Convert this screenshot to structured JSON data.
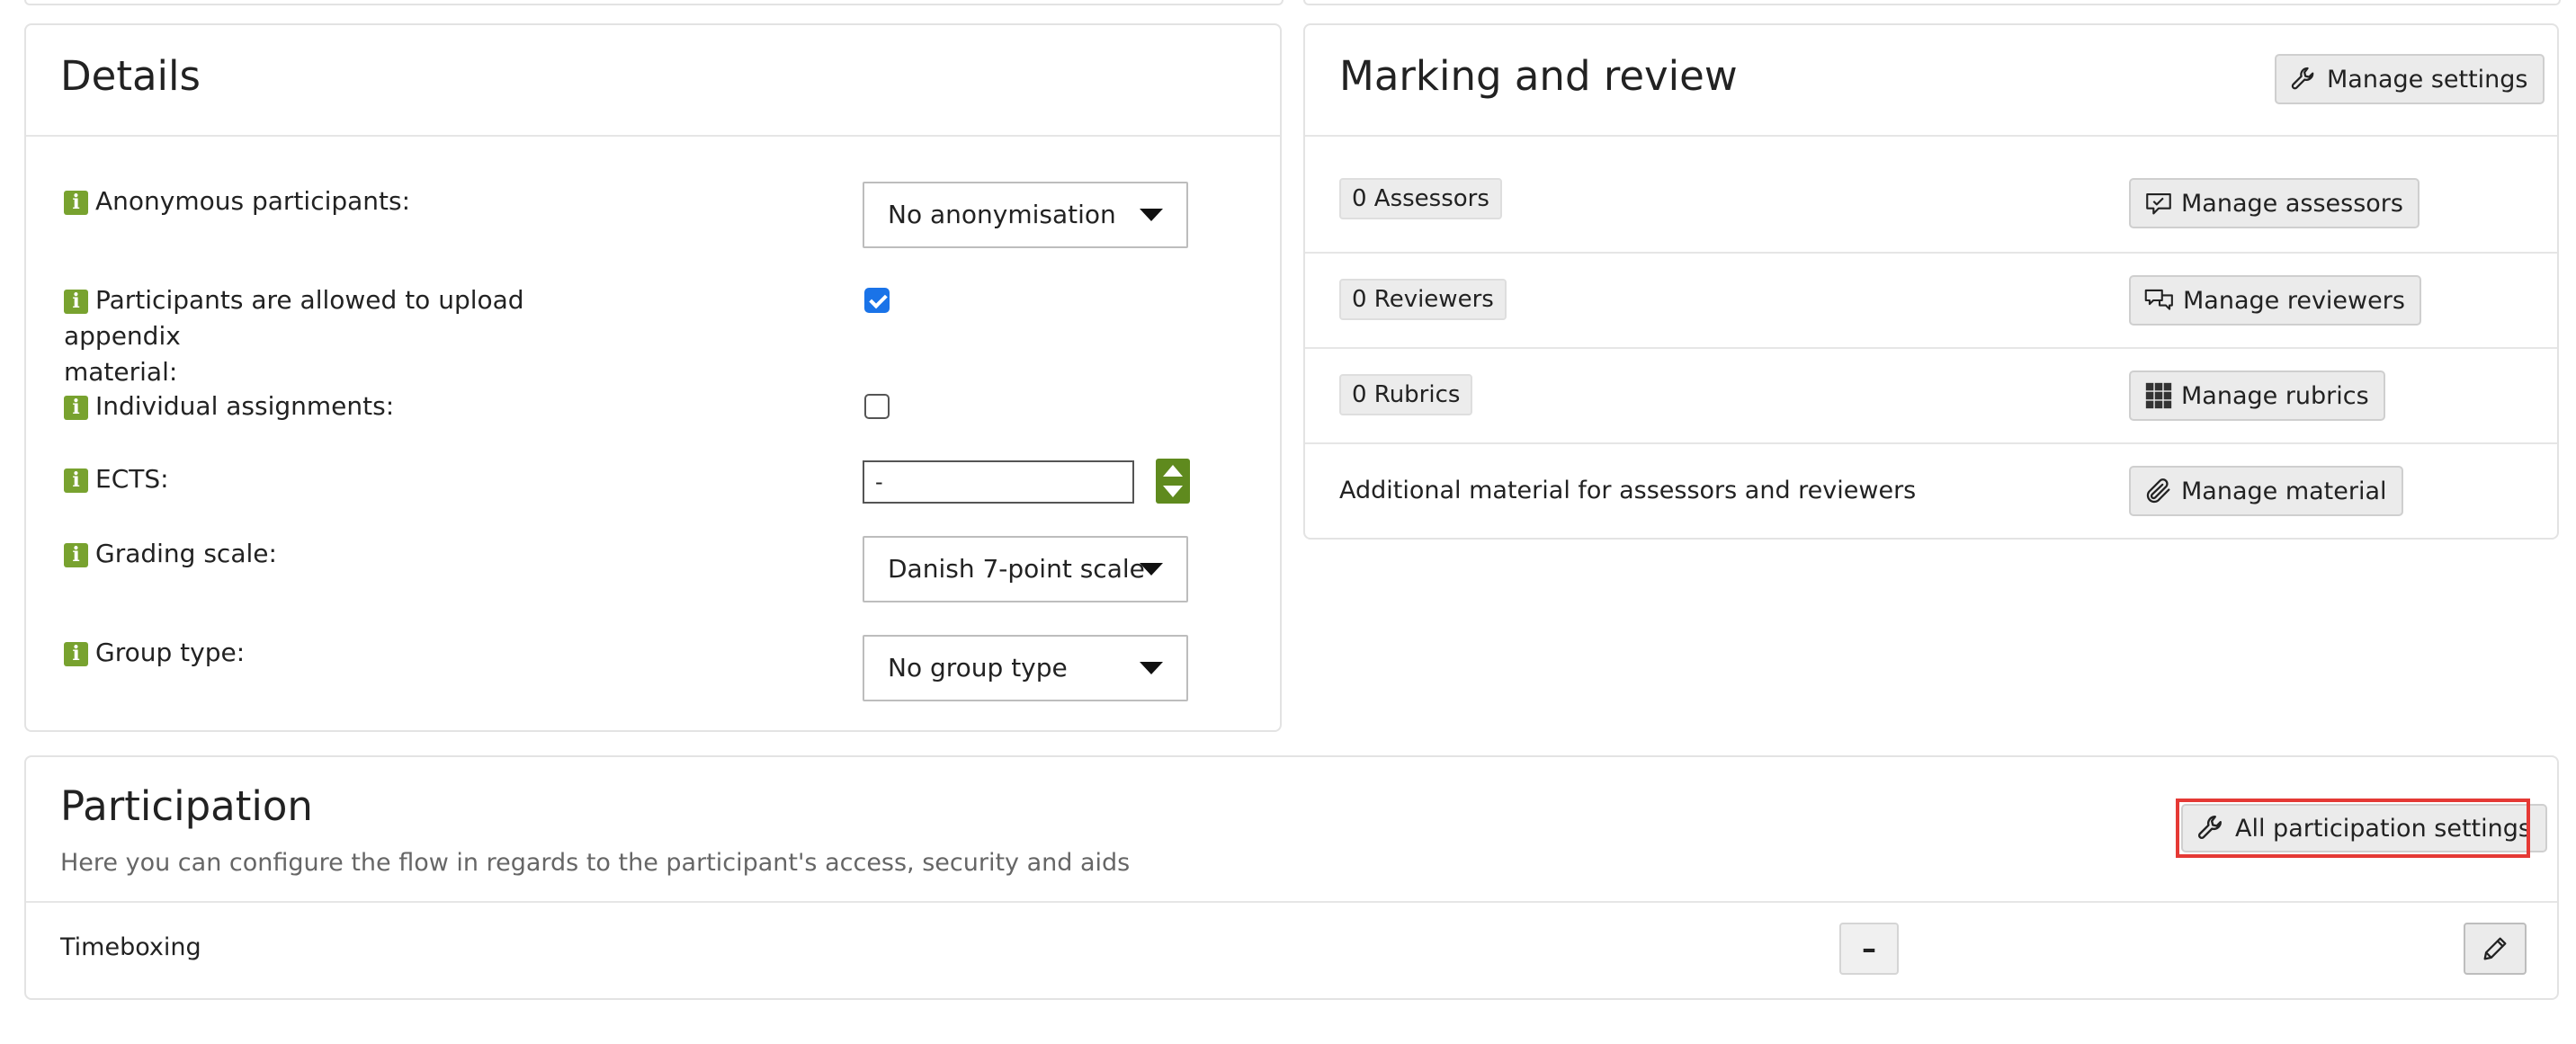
{
  "details": {
    "title": "Details",
    "fields": {
      "anonymous_label": "Anonymous participants:",
      "anonymous_value": "No anonymisation",
      "appendix_label_line1": "Participants are allowed to upload appendix",
      "appendix_label_line2": "material:",
      "appendix_checked": true,
      "individual_label": "Individual assignments:",
      "individual_checked": false,
      "ects_label": "ECTS:",
      "ects_value": "-",
      "grading_label": "Grading scale:",
      "grading_value": "Danish 7-point scale",
      "group_label": "Group type:",
      "group_value": "No group type"
    },
    "info_glyph": "i"
  },
  "marking": {
    "title": "Marking and review",
    "manage_settings_label": "Manage settings",
    "rows": {
      "assessors_count": "0 Assessors",
      "assessors_button": "Manage assessors",
      "reviewers_count": "0 Reviewers",
      "reviewers_button": "Manage reviewers",
      "rubrics_count": "0 Rubrics",
      "rubrics_button": "Manage rubrics",
      "material_text": "Additional material for assessors and reviewers",
      "material_button": "Manage material"
    }
  },
  "participation": {
    "title": "Participation",
    "subtitle": "Here you can configure the flow in regards to the participant's access, security and aids",
    "all_settings_label": "All participation settings",
    "timeboxing_label": "Timeboxing",
    "timeboxing_value": "–"
  },
  "colors": {
    "info_icon": "#78a22f",
    "stepper": "#5f8a1e",
    "checkbox": "#1a73e8",
    "highlight": "#e53935"
  },
  "icons": [
    "info-icon",
    "wrench-icon",
    "speech-bubble-check-icon",
    "speech-bubbles-icon",
    "grid-icon",
    "paperclip-icon",
    "pencil-icon",
    "caret-down-icon"
  ]
}
